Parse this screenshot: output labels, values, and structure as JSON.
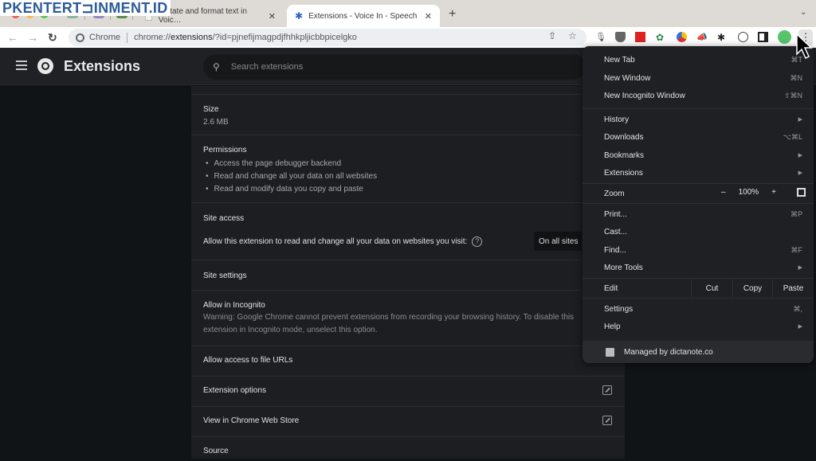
{
  "watermark": "PKENTERT⊐INMENT.ID",
  "tabs": [
    {
      "label": "Dictate and format text in Voic…",
      "active": false
    },
    {
      "label": "Extensions - Voice In - Speech",
      "active": true
    }
  ],
  "tab_close": "✕",
  "new_tab": "+",
  "address": {
    "site_label": "Chrome",
    "url_prefix": "chrome://",
    "url_bold": "extensions",
    "url_suffix": "/?id=pjnefijmagpdjfhhkpljicbbpicelgko"
  },
  "app": {
    "title": "Extensions",
    "search_placeholder": "Search extensions"
  },
  "details": {
    "size_label": "Size",
    "size_value": "2.6 MB",
    "permissions_label": "Permissions",
    "permissions": [
      "Access the page debugger backend",
      "Read and change all your data on all websites",
      "Read and modify data you copy and paste"
    ],
    "site_access_label": "Site access",
    "site_access_desc": "Allow this extension to read and change all your data on websites you visit:",
    "site_access_value": "On all sites",
    "site_settings_label": "Site settings",
    "incognito_label": "Allow in Incognito",
    "incognito_warning": "Warning: Google Chrome cannot prevent extensions from recording your browsing history. To disable this extension in Incognito mode, unselect this option.",
    "file_urls_label": "Allow access to file URLs",
    "ext_options_label": "Extension options",
    "web_store_label": "View in Chrome Web Store",
    "source_label": "Source"
  },
  "menu": {
    "items": [
      {
        "label": "New Tab",
        "shortcut": "⌘T"
      },
      {
        "label": "New Window",
        "shortcut": "⌘N"
      },
      {
        "label": "New Incognito Window",
        "shortcut": "⇧⌘N"
      },
      {
        "label": "History",
        "submenu": true
      },
      {
        "label": "Downloads",
        "shortcut": "⌥⌘L"
      },
      {
        "label": "Bookmarks",
        "submenu": true
      },
      {
        "label": "Extensions",
        "submenu": true
      },
      {
        "label": "Print...",
        "shortcut": "⌘P"
      },
      {
        "label": "Cast..."
      },
      {
        "label": "Find...",
        "shortcut": "⌘F"
      },
      {
        "label": "More Tools",
        "submenu": true
      },
      {
        "label": "Settings",
        "shortcut": "⌘,"
      },
      {
        "label": "Help",
        "submenu": true
      }
    ],
    "zoom": {
      "label": "Zoom",
      "minus": "–",
      "value": "100%",
      "plus": "+"
    },
    "edit": {
      "label": "Edit",
      "cut": "Cut",
      "copy": "Copy",
      "paste": "Paste"
    },
    "managed": "Managed by dictanote.co",
    "submenu_arrow": "▶"
  }
}
